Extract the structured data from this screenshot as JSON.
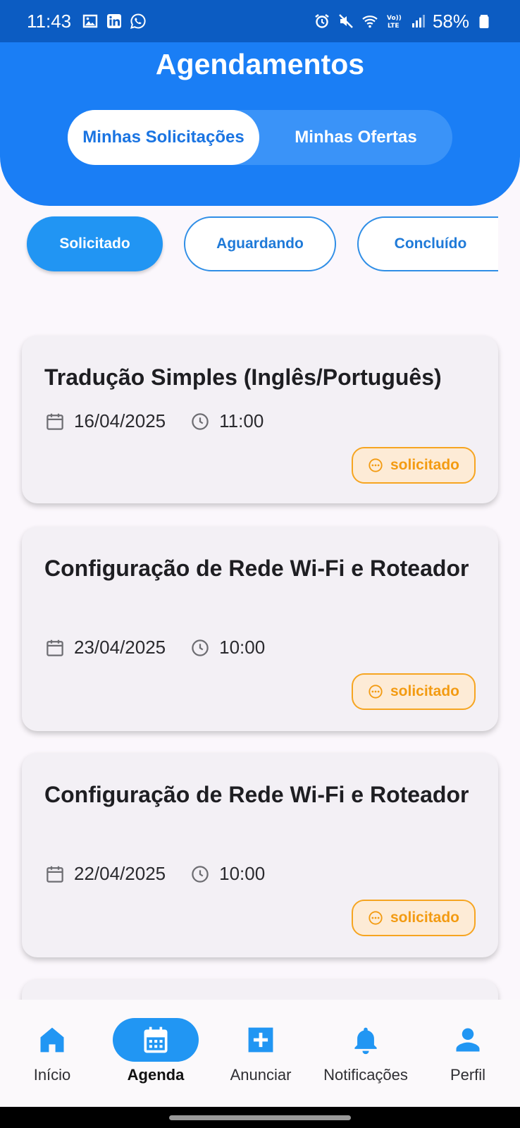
{
  "status_bar": {
    "time": "11:43",
    "battery": "58%",
    "left_icons": [
      "image-icon",
      "linkedin-icon",
      "whatsapp-icon"
    ],
    "right_icons": [
      "alarm-icon",
      "mute-icon",
      "wifi-icon",
      "volte-icon",
      "signal-icon",
      "battery-icon"
    ]
  },
  "header": {
    "title": "Agendamentos",
    "segments": [
      {
        "label": "Minhas Solicitações",
        "active": true
      },
      {
        "label": "Minhas Ofertas",
        "active": false
      }
    ],
    "accent_color": "#1a7ef5"
  },
  "filters": [
    {
      "label": "Solicitado",
      "active": true
    },
    {
      "label": "Aguardando",
      "active": false
    },
    {
      "label": "Concluído",
      "active": false
    }
  ],
  "appointments": [
    {
      "title": "Tradução Simples (Inglês/Português)",
      "date": "16/04/2025",
      "time": "11:00",
      "status": "solicitado"
    },
    {
      "title": "Configuração de Rede Wi-Fi e Roteador",
      "date": "23/04/2025",
      "time": "10:00",
      "status": "solicitado"
    },
    {
      "title": "Configuração de Rede Wi-Fi e Roteador",
      "date": "22/04/2025",
      "time": "10:00",
      "status": "solicitado"
    }
  ],
  "status_color": "#f39b12",
  "bottom_nav": [
    {
      "label": "Início",
      "icon": "home-icon",
      "active": false
    },
    {
      "label": "Agenda",
      "icon": "calendar-icon",
      "active": true
    },
    {
      "label": "Anunciar",
      "icon": "add-box-icon",
      "active": false
    },
    {
      "label": "Notificações",
      "icon": "bell-icon",
      "active": false
    },
    {
      "label": "Perfil",
      "icon": "person-icon",
      "active": false
    }
  ]
}
